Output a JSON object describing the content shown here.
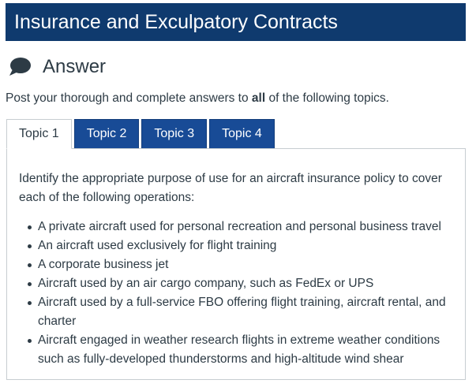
{
  "header": {
    "title": "Insurance and Exculpatory Contracts"
  },
  "answer": {
    "icon": "speech-bubble-icon",
    "label": "Answer"
  },
  "intro": {
    "before": "Post your thorough and complete answers to ",
    "bold": "all",
    "after": " of the following topics."
  },
  "tabs": [
    {
      "label": "Topic 1",
      "active": true
    },
    {
      "label": "Topic 2",
      "active": false
    },
    {
      "label": "Topic 3",
      "active": false
    },
    {
      "label": "Topic 4",
      "active": false
    }
  ],
  "panel": {
    "prompt": "Identify the appropriate purpose of use for an aircraft insurance policy to cover each of the following operations:",
    "items": [
      "A private aircraft used for personal recreation and personal business travel",
      "An aircraft used exclusively for flight training",
      "A corporate business jet",
      "Aircraft used by an air cargo company, such as FedEx or UPS",
      "Aircraft used by a full-service FBO offering flight training, aircraft rental, and charter",
      "Aircraft engaged in weather research flights in extreme weather conditions such as fully-developed thunderstorms and high-altitude wind shear"
    ]
  },
  "colors": {
    "title_bar": "#0f3a6e",
    "tab_inactive": "#184b96",
    "text": "#2d3b45"
  }
}
